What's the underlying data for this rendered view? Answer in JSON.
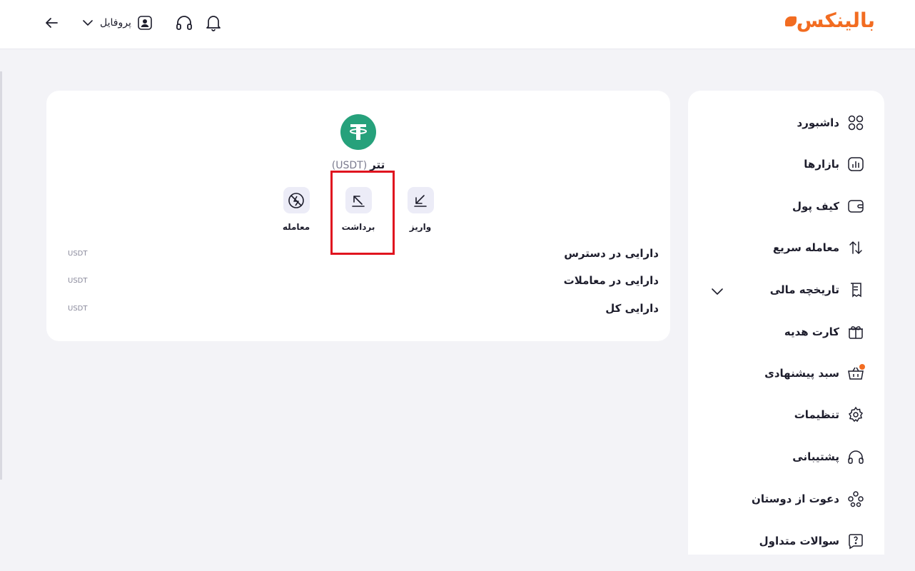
{
  "header": {
    "logo_text": "بالینکس",
    "profile_label": "پروفایل",
    "icons": [
      "back-arrow-icon",
      "chevron-down-icon",
      "user-icon",
      "headphones-icon",
      "bell-icon"
    ]
  },
  "asset": {
    "name": "تتر",
    "symbol": "(USDT)",
    "icon": "tether-icon",
    "actions": [
      {
        "label": "واریز",
        "icon": "deposit-arrow-icon"
      },
      {
        "label": "برداشت",
        "icon": "withdraw-arrow-icon"
      },
      {
        "label": "معامله",
        "icon": "trade-icon"
      }
    ],
    "balances": [
      {
        "label": "دارایی در دسترس",
        "unit": "USDT"
      },
      {
        "label": "دارایی در معاملات",
        "unit": "USDT"
      },
      {
        "label": "دارایی کل",
        "unit": "USDT"
      }
    ]
  },
  "sidebar": {
    "items": [
      {
        "label": "داشبورد",
        "icon": "grid-icon"
      },
      {
        "label": "بازارها",
        "icon": "chart-icon"
      },
      {
        "label": "کیف پول",
        "icon": "wallet-icon"
      },
      {
        "label": "معامله سریع",
        "icon": "swap-icon"
      },
      {
        "label": "تاریخچه مالی",
        "icon": "receipt-icon"
      },
      {
        "label": "کارت هدیه",
        "icon": "gift-icon"
      },
      {
        "label": "سبد پیشنهادی",
        "icon": "basket-icon"
      },
      {
        "label": "تنظیمات",
        "icon": "gear-icon"
      },
      {
        "label": "پشتیبانی",
        "icon": "headphones-icon"
      },
      {
        "label": "دعوت از دوستان",
        "icon": "users-icon"
      },
      {
        "label": "سوالات متداول",
        "icon": "question-icon"
      }
    ]
  },
  "colors": {
    "brand": "#f26c21",
    "tether": "#26a17b",
    "highlight": "#e0141f",
    "action_bg": "#ececf7"
  }
}
